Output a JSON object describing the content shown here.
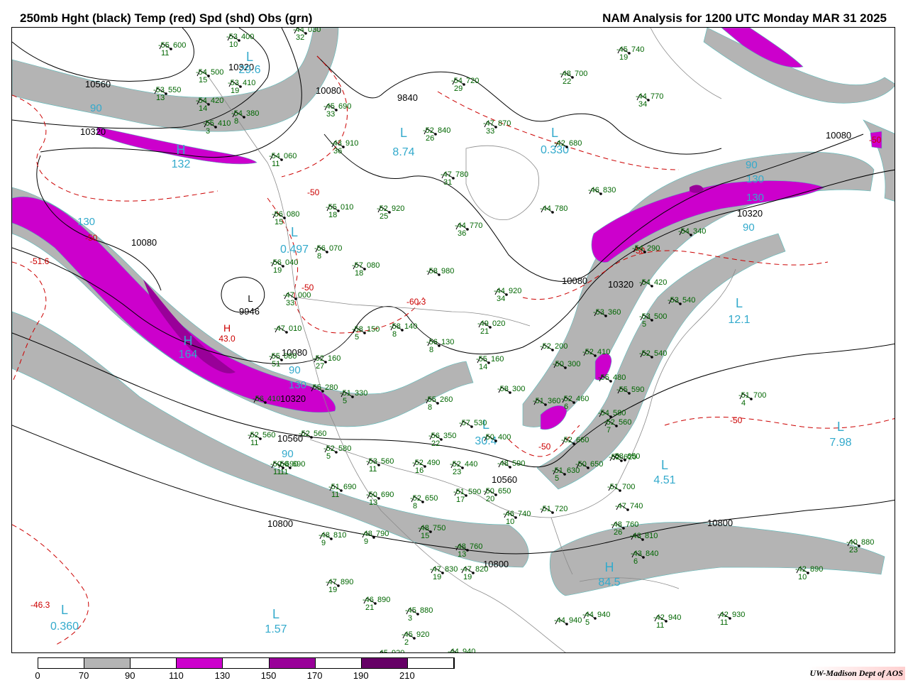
{
  "header": {
    "left_title": "250mb Hght (black) Temp (red) Spd (shd) Obs (grn)",
    "right_title": "NAM Analysis for 1200 UTC Monday  MAR 31 2025"
  },
  "colors": {
    "height_contour": "#000000",
    "temperature_contour": "#cc0000",
    "observation": "#006600",
    "extrema_label": "#33aacc",
    "speed_70_90": "#b4b4b4",
    "speed_110_130": "#cc00cc",
    "speed_150_170": "#990099",
    "speed_190_210": "#660066"
  },
  "legend": {
    "ticks": [
      "0",
      "70",
      "90",
      "110",
      "130",
      "150",
      "170",
      "190",
      "210"
    ],
    "fills": [
      "#ffffff",
      "#b4b4b4",
      "#ffffff",
      "#cc00cc",
      "#ffffff",
      "#990099",
      "#ffffff",
      "#660066",
      "#ffffff"
    ]
  },
  "credit": "UW-Madison   Dept of AOS",
  "height_labels": [
    "10560",
    "10320",
    "10320",
    "10080",
    "9840",
    "10080",
    "10080",
    "10320",
    "10080",
    "9946",
    "10320",
    "10560",
    "10560",
    "10800",
    "10800",
    "10800",
    "10320",
    "10080"
  ],
  "temperature_labels": [
    "-50",
    "-50",
    "-51.6",
    "-50",
    "-50",
    "-50",
    "-60.3",
    "-46.3",
    "-50",
    "-50"
  ],
  "extrema": [
    {
      "letter": "H",
      "value": "132"
    },
    {
      "letter": "L",
      "value": "29.6"
    },
    {
      "letter": "L",
      "value": "8.74"
    },
    {
      "letter": "L",
      "value": "0.330"
    },
    {
      "letter": "L",
      "value": "0.497"
    },
    {
      "letter": "H",
      "value": "164"
    },
    {
      "letter": "L",
      "value": "12.1"
    },
    {
      "letter": "L",
      "value": "7.98"
    },
    {
      "letter": "L",
      "value": "4.51"
    },
    {
      "letter": "H",
      "value": "84.5"
    },
    {
      "letter": "L",
      "value": "0.360"
    },
    {
      "letter": "L",
      "value": "1.57"
    },
    {
      "letter": "L",
      "value": "30.4"
    },
    {
      "letter": "H",
      "value": "43.0"
    },
    {
      "letter": "L",
      "value": "9946"
    }
  ],
  "speed_labels": [
    "90",
    "130",
    "90",
    "130",
    "90",
    "90",
    "130",
    "90",
    "130"
  ],
  "observations": [
    {
      "temp": "-55",
      "value": "600",
      "dew": "11"
    },
    {
      "temp": "-53",
      "value": "400",
      "dew": "10"
    },
    {
      "temp": "-44",
      "value": "030",
      "dew": "32"
    },
    {
      "temp": "-54",
      "value": "500",
      "dew": "15"
    },
    {
      "temp": "-53",
      "value": "410",
      "dew": "19"
    },
    {
      "temp": "-53",
      "value": "550",
      "dew": "13"
    },
    {
      "temp": "-54",
      "value": "420",
      "dew": "14"
    },
    {
      "temp": "-54",
      "value": "380",
      "dew": "8"
    },
    {
      "temp": "-55",
      "value": "410",
      "dew": "3"
    },
    {
      "temp": "-45",
      "value": "690",
      "dew": "33"
    },
    {
      "temp": "-54",
      "value": "720",
      "dew": "29"
    },
    {
      "temp": "-48",
      "value": "700",
      "dew": "22"
    },
    {
      "temp": "-45",
      "value": "740",
      "dew": "19"
    },
    {
      "temp": "-44",
      "value": "770",
      "dew": "34"
    },
    {
      "temp": "-52",
      "value": "840",
      "dew": "26"
    },
    {
      "temp": "-47",
      "value": "870",
      "dew": "33"
    },
    {
      "temp": "-43",
      "value": "910",
      "dew": "36"
    },
    {
      "temp": "-42",
      "value": "680",
      "dew": ""
    },
    {
      "temp": "-54",
      "value": "060",
      "dew": "11"
    },
    {
      "temp": "-47",
      "value": "780",
      "dew": "31"
    },
    {
      "temp": "-46",
      "value": "830",
      "dew": ""
    },
    {
      "temp": "-44",
      "value": "780",
      "dew": ""
    },
    {
      "temp": "-55",
      "value": "010",
      "dew": "18"
    },
    {
      "temp": "-52",
      "value": "920",
      "dew": "25"
    },
    {
      "temp": "-44",
      "value": "770",
      "dew": "36"
    },
    {
      "temp": "-56",
      "value": "080",
      "dew": "15"
    },
    {
      "temp": "-56",
      "value": "070",
      "dew": "8"
    },
    {
      "temp": "-56",
      "value": "040",
      "dew": "19"
    },
    {
      "temp": "-57",
      "value": "080",
      "dew": "18"
    },
    {
      "temp": "-58",
      "value": "980",
      "dew": ""
    },
    {
      "temp": "-54",
      "value": "290",
      "dew": ""
    },
    {
      "temp": "-54",
      "value": "340",
      "dew": ""
    },
    {
      "temp": "-54",
      "value": "420",
      "dew": ""
    },
    {
      "temp": "-44",
      "value": "920",
      "dew": "34"
    },
    {
      "temp": "-47",
      "value": "000",
      "dew": "33"
    },
    {
      "temp": "-53",
      "value": "540",
      "dew": ""
    },
    {
      "temp": "-53",
      "value": "360",
      "dew": ""
    },
    {
      "temp": "-53",
      "value": "500",
      "dew": "5"
    },
    {
      "temp": "-47",
      "value": "010",
      "dew": ""
    },
    {
      "temp": "-58",
      "value": "150",
      "dew": "5"
    },
    {
      "temp": "-58",
      "value": "140",
      "dew": "8"
    },
    {
      "temp": "-49",
      "value": "020",
      "dew": "21"
    },
    {
      "temp": "-56",
      "value": "130",
      "dew": "8"
    },
    {
      "temp": "-52",
      "value": "200",
      "dew": ""
    },
    {
      "temp": "-52",
      "value": "540",
      "dew": ""
    },
    {
      "temp": "-55",
      "value": "080",
      "dew": "51"
    },
    {
      "temp": "-52",
      "value": "160",
      "dew": "27"
    },
    {
      "temp": "-55",
      "value": "160",
      "dew": "14"
    },
    {
      "temp": "-50",
      "value": "300",
      "dew": ""
    },
    {
      "temp": "-52",
      "value": "410",
      "dew": ""
    },
    {
      "temp": "-55",
      "value": "480",
      "dew": ""
    },
    {
      "temp": "-55",
      "value": "590",
      "dew": ""
    },
    {
      "temp": "-56",
      "value": "410",
      "dew": ""
    },
    {
      "temp": "-55",
      "value": "280",
      "dew": ""
    },
    {
      "temp": "-51",
      "value": "330",
      "dew": "5"
    },
    {
      "temp": "-58",
      "value": "300",
      "dew": ""
    },
    {
      "temp": "-55",
      "value": "260",
      "dew": "8"
    },
    {
      "temp": "-51",
      "value": "360",
      "dew": ""
    },
    {
      "temp": "-52",
      "value": "460",
      "dew": "6"
    },
    {
      "temp": "-54",
      "value": "580",
      "dew": ""
    },
    {
      "temp": "-51",
      "value": "700",
      "dew": "4"
    },
    {
      "temp": "-52",
      "value": "560",
      "dew": "7"
    },
    {
      "temp": "-52",
      "value": "560",
      "dew": "11"
    },
    {
      "temp": "-57",
      "value": "530",
      "dew": ""
    },
    {
      "temp": "-56",
      "value": "350",
      "dew": "22"
    },
    {
      "temp": "-50",
      "value": "400",
      "dew": ""
    },
    {
      "temp": "-52",
      "value": "660",
      "dew": ""
    },
    {
      "temp": "-52",
      "value": "620",
      "dew": ""
    },
    {
      "temp": "-52",
      "value": "560",
      "dew": ""
    },
    {
      "temp": "-52",
      "value": "580",
      "dew": "5"
    },
    {
      "temp": "-53",
      "value": "560",
      "dew": "11"
    },
    {
      "temp": "-52",
      "value": "490",
      "dew": "16"
    },
    {
      "temp": "-52",
      "value": "440",
      "dew": "23"
    },
    {
      "temp": "-48",
      "value": "590",
      "dew": ""
    },
    {
      "temp": "-51",
      "value": "630",
      "dew": "5"
    },
    {
      "temp": "-50",
      "value": "650",
      "dew": ""
    },
    {
      "temp": "-58",
      "value": "650",
      "dew": ""
    },
    {
      "temp": "-51",
      "value": "700",
      "dew": ""
    },
    {
      "temp": "-50",
      "value": "690",
      "dew": "11"
    },
    {
      "temp": "-51",
      "value": "690",
      "dew": "11"
    },
    {
      "temp": "-50",
      "value": "690",
      "dew": "13"
    },
    {
      "temp": "-52",
      "value": "650",
      "dew": "8"
    },
    {
      "temp": "-51",
      "value": "590",
      "dew": "17"
    },
    {
      "temp": "-50",
      "value": "650",
      "dew": "20"
    },
    {
      "temp": "-46",
      "value": "740",
      "dew": "10"
    },
    {
      "temp": "-51",
      "value": "720",
      "dew": ""
    },
    {
      "temp": "-47",
      "value": "740",
      "dew": ""
    },
    {
      "temp": "-48",
      "value": "760",
      "dew": "26"
    },
    {
      "temp": "-43",
      "value": "810",
      "dew": ""
    },
    {
      "temp": "-43",
      "value": "840",
      "dew": "6"
    },
    {
      "temp": "-48",
      "value": "810",
      "dew": "9"
    },
    {
      "temp": "-48",
      "value": "790",
      "dew": "9"
    },
    {
      "temp": "-48",
      "value": "750",
      "dew": "15"
    },
    {
      "temp": "-48",
      "value": "760",
      "dew": "13"
    },
    {
      "temp": "-47",
      "value": "830",
      "dew": "19"
    },
    {
      "temp": "-47",
      "value": "820",
      "dew": "19"
    },
    {
      "temp": "-47",
      "value": "890",
      "dew": "19"
    },
    {
      "temp": "-46",
      "value": "890",
      "dew": "21"
    },
    {
      "temp": "-45",
      "value": "880",
      "dew": "3"
    },
    {
      "temp": "-45",
      "value": "920",
      "dew": "2"
    },
    {
      "temp": "-45",
      "value": "920",
      "dew": ""
    },
    {
      "temp": "-44",
      "value": "940",
      "dew": ""
    },
    {
      "temp": "-44",
      "value": "940",
      "dew": ""
    },
    {
      "temp": "-44",
      "value": "940",
      "dew": "5"
    },
    {
      "temp": "-42",
      "value": "940",
      "dew": "11"
    },
    {
      "temp": "-42",
      "value": "930",
      "dew": "11"
    },
    {
      "temp": "-42",
      "value": "890",
      "dew": "10"
    },
    {
      "temp": "-40",
      "value": "880",
      "dew": "23"
    },
    {
      "temp": "-50",
      "value": "690",
      "dew": "11"
    }
  ]
}
